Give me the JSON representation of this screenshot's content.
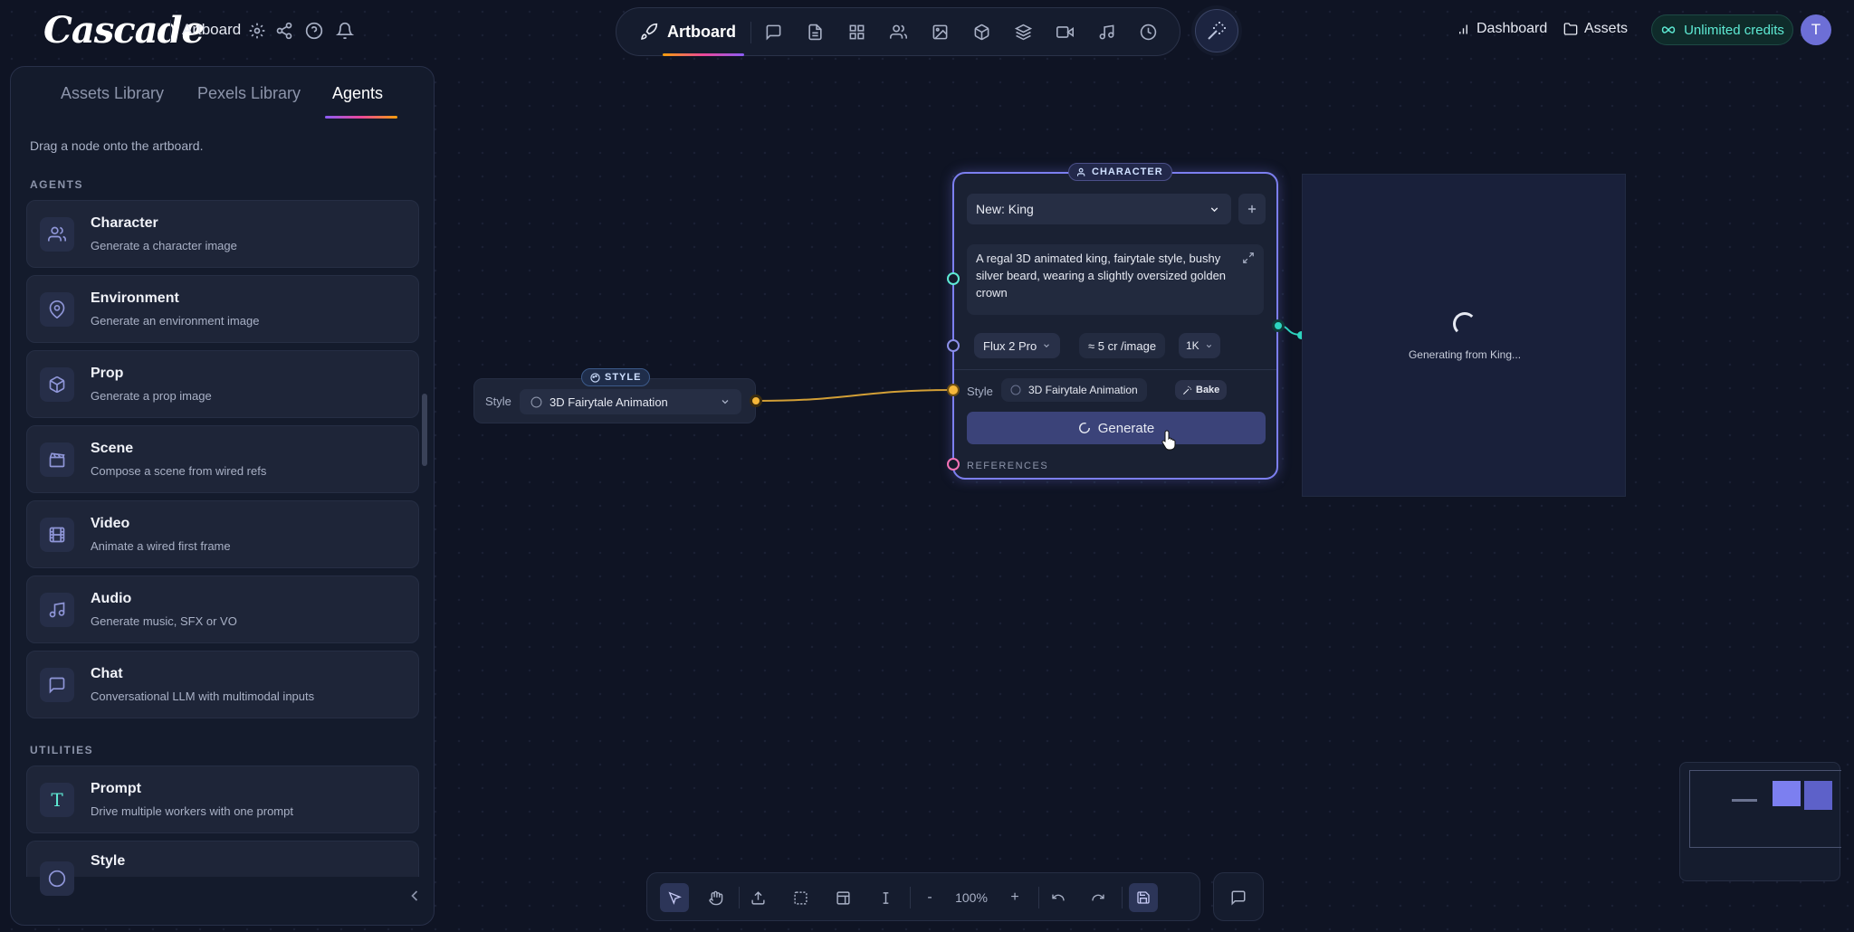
{
  "app": {
    "logo": "Cascade",
    "project_name": "Artboard"
  },
  "toolbar": {
    "active_label": "Artboard",
    "icons": [
      "chat-icon",
      "document-icon",
      "grid-icon",
      "users-icon",
      "image-icon",
      "cube-icon",
      "layers-icon",
      "video-icon",
      "music-icon",
      "clock-icon"
    ]
  },
  "header": {
    "dashboard": "Dashboard",
    "assets": "Assets",
    "credits": "Unlimited credits",
    "avatar_initial": "T"
  },
  "sidebar": {
    "tabs": [
      "Assets Library",
      "Pexels Library",
      "Agents"
    ],
    "active_tab": "Agents",
    "hint": "Drag a node onto the artboard.",
    "agents_heading": "AGENTS",
    "agents": [
      {
        "title": "Character",
        "desc": "Generate a character image",
        "icon": "users-icon"
      },
      {
        "title": "Environment",
        "desc": "Generate an environment image",
        "icon": "map-pin-icon"
      },
      {
        "title": "Prop",
        "desc": "Generate a prop image",
        "icon": "cube-icon"
      },
      {
        "title": "Scene",
        "desc": "Compose a scene from wired refs",
        "icon": "clapperboard-icon"
      },
      {
        "title": "Video",
        "desc": "Animate a wired first frame",
        "icon": "film-icon"
      },
      {
        "title": "Audio",
        "desc": "Generate music, SFX or VO",
        "icon": "music-icon"
      },
      {
        "title": "Chat",
        "desc": "Conversational LLM with multimodal inputs",
        "icon": "chat-icon"
      }
    ],
    "utilities_heading": "UTILITIES",
    "utilities": [
      {
        "title": "Prompt",
        "desc": "Drive multiple workers with one prompt",
        "icon": "text-icon",
        "glyph": "T"
      },
      {
        "title": "Style",
        "desc": "",
        "icon": "palette-icon"
      }
    ]
  },
  "style_node": {
    "badge": "STYLE",
    "label": "Style",
    "value": "3D Fairytale Animation"
  },
  "character_node": {
    "badge": "CHARACTER",
    "select_value": "New: King",
    "prompt": "A regal 3D animated king, fairytale style, bushy silver beard, wearing a slightly oversized golden crown",
    "model": "Flux 2 Pro",
    "cost": "≈ 5 cr /image",
    "resolution": "1K",
    "style_label": "Style",
    "style_value": "3D Fairytale Animation",
    "bake_label": "Bake",
    "generate_label": "Generate",
    "references_label": "REFERENCES"
  },
  "output": {
    "status": "Generating from King..."
  },
  "bottom_toolbar": {
    "zoom": "100%",
    "minus": "-",
    "plus": "+"
  },
  "colors": {
    "accent": "#7c7ff0",
    "wire": "#f5b73a",
    "teal": "#2dd4bf",
    "background": "#0f1424"
  }
}
